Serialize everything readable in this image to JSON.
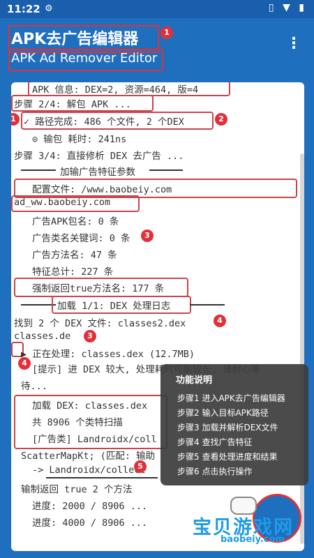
{
  "status": {
    "time": "11:22",
    "icons": "▯ ▼ ▮"
  },
  "app": {
    "title": "APK去广告编辑器",
    "subtitle": "APK Ad Remover Editor"
  },
  "log": {
    "l1": "APK 信息: DEX=2, 资源=464, 版=4",
    "l2": "步骤 2/4: 解包 APK ...",
    "l3": "✓ 路径完成: 486 个文件, 2 个DEX",
    "l4": "⊙ 输包 耗时: 241ns",
    "l5": "步骤 3/4: 直接修析 DEX 去广告 ...",
    "l6": "加输广告特征参数",
    "l7": "配置文件: /www.baobeiy.com",
    "l8": "ad_ww.baobeiy.com",
    "l9": "广告APK包名: 0 条",
    "l10": "广告类名关键词: 0 条",
    "l11": "广告方法名: 47 条",
    "l12": "特征总计: 227 条",
    "l13": "强制返回true方法名: 177 条",
    "l14": "加载 1/1: DEX 处理日志",
    "l15": "找到 2 个 DEX 文件: classes2.dex",
    "l16": "classes.de",
    "l17": "▶ 正在处理: classes.dex (12.7MB)",
    "l18": "[提示] 进 DEX 较大, 处理耗时可能较长, 请耐心等",
    "l19": "待...",
    "l20": "加载 DEX: classes.dex",
    "l21": "共 8906 个类特扫描",
    "l22": "[广告类] Landroidx/coll",
    "l23": "ScatterMapKt; (匹配: 输助",
    "l24": "-> Landroidx/collect",
    "l25": "输制返回 true 2 个方法",
    "l26": "进度: 2000 / 8906 ...",
    "l27": "进度: 4000 / 8906 ..."
  },
  "badges": {
    "b1": "1",
    "b2": "2",
    "b3": "3",
    "b4": "4",
    "b5": "5"
  },
  "popup": {
    "title": "功能说明",
    "items": [
      "步骤1 进入APK去广告编辑器",
      "步骤2 输入目标APK路径",
      "步骤3 加载并解析DEX文件",
      "步骤4 查找广告特征",
      "步骤5 查看处理进度和结果",
      "步骤6 点击执行操作"
    ]
  },
  "watermark": {
    "main": "宝贝游戏网",
    "url": "baobeiy.com"
  }
}
